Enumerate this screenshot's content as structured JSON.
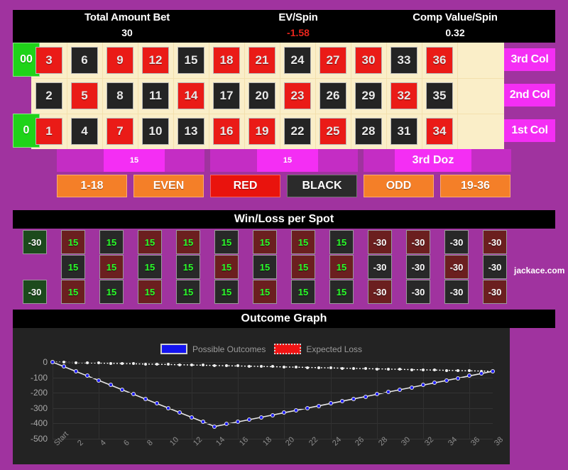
{
  "theme": {
    "page_bg": "#a0339f",
    "panel_bg": "#000000",
    "felt": "#faeec8",
    "red": "#ea1b17",
    "black": "#242424",
    "green": "#1fd319",
    "magenta": "#f42ef4",
    "orange": "#f47f28",
    "win_text": "#2aff2a",
    "ev_negative": "#e8251c"
  },
  "stats": [
    {
      "label": "Total Amount Bet",
      "value": "30",
      "negative": false
    },
    {
      "label": "EV/Spin",
      "value": "-1.58",
      "negative": true
    },
    {
      "label": "Comp Value/Spin",
      "value": "0.32",
      "negative": false
    }
  ],
  "table": {
    "zeros": [
      {
        "label": "00",
        "name": "double-zero-cell"
      },
      {
        "label": "0",
        "name": "zero-cell"
      }
    ],
    "numbers": [
      {
        "n": "3",
        "color": "red",
        "row": 0,
        "col": 0
      },
      {
        "n": "6",
        "color": "black",
        "row": 0,
        "col": 1
      },
      {
        "n": "9",
        "color": "red",
        "row": 0,
        "col": 2
      },
      {
        "n": "12",
        "color": "red",
        "row": 0,
        "col": 3
      },
      {
        "n": "15",
        "color": "black",
        "row": 0,
        "col": 4
      },
      {
        "n": "18",
        "color": "red",
        "row": 0,
        "col": 5
      },
      {
        "n": "21",
        "color": "red",
        "row": 0,
        "col": 6
      },
      {
        "n": "24",
        "color": "black",
        "row": 0,
        "col": 7
      },
      {
        "n": "27",
        "color": "red",
        "row": 0,
        "col": 8
      },
      {
        "n": "30",
        "color": "red",
        "row": 0,
        "col": 9
      },
      {
        "n": "33",
        "color": "black",
        "row": 0,
        "col": 10
      },
      {
        "n": "36",
        "color": "red",
        "row": 0,
        "col": 11
      },
      {
        "n": "2",
        "color": "black",
        "row": 1,
        "col": 0
      },
      {
        "n": "5",
        "color": "red",
        "row": 1,
        "col": 1
      },
      {
        "n": "8",
        "color": "black",
        "row": 1,
        "col": 2
      },
      {
        "n": "11",
        "color": "black",
        "row": 1,
        "col": 3
      },
      {
        "n": "14",
        "color": "red",
        "row": 1,
        "col": 4
      },
      {
        "n": "17",
        "color": "black",
        "row": 1,
        "col": 5
      },
      {
        "n": "20",
        "color": "black",
        "row": 1,
        "col": 6
      },
      {
        "n": "23",
        "color": "red",
        "row": 1,
        "col": 7
      },
      {
        "n": "26",
        "color": "black",
        "row": 1,
        "col": 8
      },
      {
        "n": "29",
        "color": "black",
        "row": 1,
        "col": 9
      },
      {
        "n": "32",
        "color": "red",
        "row": 1,
        "col": 10
      },
      {
        "n": "35",
        "color": "black",
        "row": 1,
        "col": 11
      },
      {
        "n": "1",
        "color": "red",
        "row": 2,
        "col": 0
      },
      {
        "n": "4",
        "color": "black",
        "row": 2,
        "col": 1
      },
      {
        "n": "7",
        "color": "red",
        "row": 2,
        "col": 2
      },
      {
        "n": "10",
        "color": "black",
        "row": 2,
        "col": 3
      },
      {
        "n": "13",
        "color": "black",
        "row": 2,
        "col": 4
      },
      {
        "n": "16",
        "color": "red",
        "row": 2,
        "col": 5
      },
      {
        "n": "19",
        "color": "red",
        "row": 2,
        "col": 6
      },
      {
        "n": "22",
        "color": "black",
        "row": 2,
        "col": 7
      },
      {
        "n": "25",
        "color": "red",
        "row": 2,
        "col": 8
      },
      {
        "n": "28",
        "color": "black",
        "row": 2,
        "col": 9
      },
      {
        "n": "31",
        "color": "black",
        "row": 2,
        "col": 10
      },
      {
        "n": "34",
        "color": "red",
        "row": 2,
        "col": 11
      }
    ],
    "column_bets": [
      {
        "label": "3rd Col",
        "name": "column-bet-3"
      },
      {
        "label": "2nd Col",
        "name": "column-bet-2"
      },
      {
        "label": "1st Col",
        "name": "column-bet-1"
      }
    ],
    "dozen_bets": [
      {
        "label": "15",
        "name": "dozen-bet-1",
        "chip": true
      },
      {
        "label": "15",
        "name": "dozen-bet-2",
        "chip": true
      },
      {
        "label": "3rd Doz",
        "name": "dozen-bet-3",
        "chip": true
      }
    ],
    "outside_bets": [
      {
        "label": "1-18",
        "style": "orange",
        "name": "bet-low"
      },
      {
        "label": "EVEN",
        "style": "orange",
        "name": "bet-even"
      },
      {
        "label": "RED",
        "style": "red",
        "name": "bet-red"
      },
      {
        "label": "BLACK",
        "style": "black",
        "name": "bet-black"
      },
      {
        "label": "ODD",
        "style": "orange",
        "name": "bet-odd"
      },
      {
        "label": "19-36",
        "style": "orange",
        "name": "bet-high"
      }
    ]
  },
  "winloss": {
    "title": "Win/Loss per Spot",
    "brand": "jackace.com",
    "cells": [
      {
        "v": "-30",
        "bg": "bggreen",
        "kind": "lose",
        "row": 0,
        "col": 0
      },
      {
        "v": "-30",
        "bg": "bggreen",
        "kind": "lose",
        "row": 2,
        "col": 0
      },
      {
        "v": "15",
        "bg": "bgred",
        "kind": "win",
        "row": 0,
        "col": 1
      },
      {
        "v": "15",
        "bg": "bgblack",
        "kind": "win",
        "row": 1,
        "col": 1
      },
      {
        "v": "15",
        "bg": "bgred",
        "kind": "win",
        "row": 2,
        "col": 1
      },
      {
        "v": "15",
        "bg": "bgblack",
        "kind": "win",
        "row": 0,
        "col": 2
      },
      {
        "v": "15",
        "bg": "bgred",
        "kind": "win",
        "row": 1,
        "col": 2
      },
      {
        "v": "15",
        "bg": "bgblack",
        "kind": "win",
        "row": 2,
        "col": 2
      },
      {
        "v": "15",
        "bg": "bgred",
        "kind": "win",
        "row": 0,
        "col": 3
      },
      {
        "v": "15",
        "bg": "bgblack",
        "kind": "win",
        "row": 1,
        "col": 3
      },
      {
        "v": "15",
        "bg": "bgred",
        "kind": "win",
        "row": 2,
        "col": 3
      },
      {
        "v": "15",
        "bg": "bgred",
        "kind": "win",
        "row": 0,
        "col": 4
      },
      {
        "v": "15",
        "bg": "bgblack",
        "kind": "win",
        "row": 1,
        "col": 4
      },
      {
        "v": "15",
        "bg": "bgblack",
        "kind": "win",
        "row": 2,
        "col": 4
      },
      {
        "v": "15",
        "bg": "bgblack",
        "kind": "win",
        "row": 0,
        "col": 5
      },
      {
        "v": "15",
        "bg": "bgred",
        "kind": "win",
        "row": 1,
        "col": 5
      },
      {
        "v": "15",
        "bg": "bgblack",
        "kind": "win",
        "row": 2,
        "col": 5
      },
      {
        "v": "15",
        "bg": "bgred",
        "kind": "win",
        "row": 0,
        "col": 6
      },
      {
        "v": "15",
        "bg": "bgblack",
        "kind": "win",
        "row": 1,
        "col": 6
      },
      {
        "v": "15",
        "bg": "bgred",
        "kind": "win",
        "row": 2,
        "col": 6
      },
      {
        "v": "15",
        "bg": "bgred",
        "kind": "win",
        "row": 0,
        "col": 7
      },
      {
        "v": "15",
        "bg": "bgred",
        "kind": "win",
        "row": 1,
        "col": 7
      },
      {
        "v": "15",
        "bg": "bgblack",
        "kind": "win",
        "row": 2,
        "col": 7
      },
      {
        "v": "15",
        "bg": "bgblack",
        "kind": "win",
        "row": 0,
        "col": 8
      },
      {
        "v": "15",
        "bg": "bgred",
        "kind": "win",
        "row": 1,
        "col": 8
      },
      {
        "v": "15",
        "bg": "bgblack",
        "kind": "win",
        "row": 2,
        "col": 8
      },
      {
        "v": "-30",
        "bg": "bgred",
        "kind": "lose",
        "row": 0,
        "col": 9
      },
      {
        "v": "-30",
        "bg": "bgblack",
        "kind": "lose",
        "row": 1,
        "col": 9
      },
      {
        "v": "-30",
        "bg": "bgred",
        "kind": "lose",
        "row": 2,
        "col": 9
      },
      {
        "v": "-30",
        "bg": "bgred",
        "kind": "lose",
        "row": 0,
        "col": 10
      },
      {
        "v": "-30",
        "bg": "bgblack",
        "kind": "lose",
        "row": 1,
        "col": 10
      },
      {
        "v": "-30",
        "bg": "bgblack",
        "kind": "lose",
        "row": 2,
        "col": 10
      },
      {
        "v": "-30",
        "bg": "bgblack",
        "kind": "lose",
        "row": 0,
        "col": 11
      },
      {
        "v": "-30",
        "bg": "bgred",
        "kind": "lose",
        "row": 1,
        "col": 11
      },
      {
        "v": "-30",
        "bg": "bgblack",
        "kind": "lose",
        "row": 2,
        "col": 11
      },
      {
        "v": "-30",
        "bg": "bgred",
        "kind": "lose",
        "row": 0,
        "col": 12
      },
      {
        "v": "-30",
        "bg": "bgblack",
        "kind": "lose",
        "row": 1,
        "col": 12
      },
      {
        "v": "-30",
        "bg": "bgred",
        "kind": "lose",
        "row": 2,
        "col": 12
      }
    ]
  },
  "chart_data": {
    "type": "line",
    "title": "Outcome Graph",
    "xlabel": "",
    "ylabel": "",
    "grid": true,
    "legend_position": "top-center",
    "ylim": [
      -500,
      0
    ],
    "yticks": [
      0,
      -100,
      -200,
      -300,
      -400,
      -500
    ],
    "ytick_labels": [
      "0",
      "-100",
      "-200",
      "-300",
      "-400",
      "-500"
    ],
    "x": [
      "Start",
      "1",
      "2",
      "3",
      "4",
      "5",
      "6",
      "7",
      "8",
      "9",
      "10",
      "11",
      "12",
      "13",
      "14",
      "15",
      "16",
      "17",
      "18",
      "19",
      "20",
      "21",
      "22",
      "23",
      "24",
      "25",
      "26",
      "27",
      "28",
      "29",
      "30",
      "31",
      "32",
      "33",
      "34",
      "35",
      "36",
      "37",
      "38"
    ],
    "xtick_labels": [
      "Start",
      "2",
      "4",
      "6",
      "8",
      "10",
      "12",
      "14",
      "16",
      "18",
      "20",
      "22",
      "24",
      "26",
      "28",
      "30",
      "32",
      "34",
      "36",
      "38"
    ],
    "series": [
      {
        "name": "Possible Outcomes",
        "color": "#1414f0",
        "style": "solid",
        "values": [
          0,
          -30,
          -60,
          -90,
          -120,
          -150,
          -180,
          -210,
          -240,
          -270,
          -300,
          -330,
          -360,
          -390,
          -420,
          -405,
          -390,
          -375,
          -360,
          -345,
          -330,
          -315,
          -300,
          -285,
          -270,
          -255,
          -240,
          -225,
          -210,
          -195,
          -180,
          -165,
          -150,
          -135,
          -120,
          -105,
          -90,
          -75,
          -60
        ]
      },
      {
        "name": "Expected Loss",
        "color": "#f01414",
        "style": "dotted",
        "values": [
          0,
          -1.58,
          -3.16,
          -4.74,
          -6.32,
          -7.9,
          -9.48,
          -11.06,
          -12.64,
          -14.22,
          -15.8,
          -17.38,
          -18.96,
          -20.54,
          -22.12,
          -23.7,
          -25.28,
          -26.86,
          -28.44,
          -30.02,
          -31.6,
          -33.18,
          -34.76,
          -36.34,
          -37.92,
          -39.5,
          -41.08,
          -42.66,
          -44.24,
          -45.82,
          -47.4,
          -48.98,
          -50.56,
          -52.14,
          -53.72,
          -55.3,
          -56.88,
          -58.46,
          -60.04
        ]
      }
    ]
  }
}
